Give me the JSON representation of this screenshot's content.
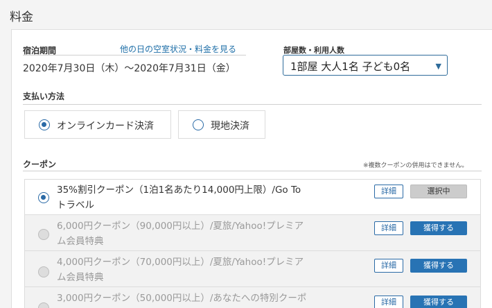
{
  "page": {
    "title": "料金"
  },
  "stay": {
    "label": "宿泊期間",
    "other_dates_link": "他の日の空室状況・料金を見る",
    "dates": "2020年7月30日（木）～2020年7月31日（金）"
  },
  "rooms": {
    "label": "部屋数・利用人数",
    "selected": "1部屋 大人1名 子ども0名"
  },
  "payment": {
    "label": "支払い方法",
    "options": [
      {
        "label": "オンラインカード決済",
        "selected": true
      },
      {
        "label": "現地決済",
        "selected": false
      }
    ]
  },
  "coupon": {
    "label": "クーポン",
    "note": "※複数クーポンの併用はできません。",
    "detail_label": "詳細",
    "items": [
      {
        "line1": "35%割引クーポン（1泊1名あたり14,000円上限）/Go To",
        "line2": "トラベル",
        "action": "選択中",
        "selected": true
      },
      {
        "line1": "6,000円クーポン（90,000円以上）/夏旅/Yahoo!プレミア",
        "line2": "ム会員特典",
        "action": "獲得する",
        "selected": false
      },
      {
        "line1": "4,000円クーポン（70,000円以上）/夏旅/Yahoo!プレミア",
        "line2": "ム会員特典",
        "action": "獲得する",
        "selected": false
      },
      {
        "line1": "3,000円クーポン（50,000円以上）/あなたへの特別クーポ",
        "line2": "",
        "action": "獲得する",
        "selected": false
      }
    ]
  },
  "colors": {
    "accent": "#2873b4",
    "link": "#1f6fa8",
    "selected_button": "#cccccc"
  }
}
